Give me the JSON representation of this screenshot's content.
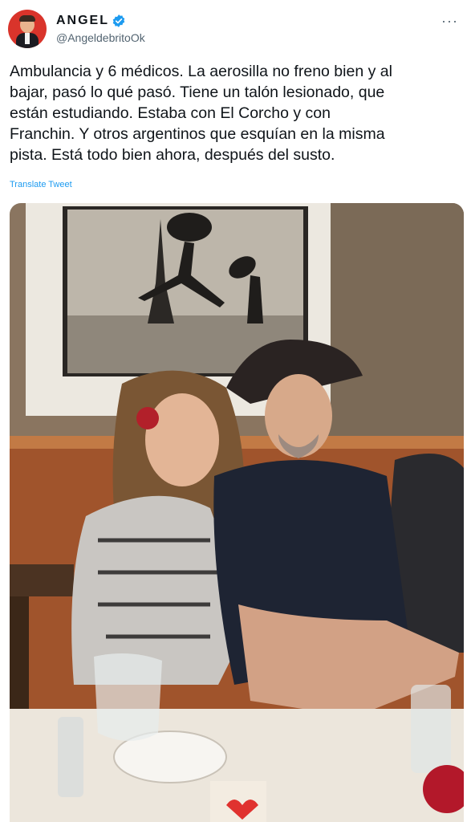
{
  "author": {
    "display_name": "ANGEL",
    "handle": "@AngeldebritoOk",
    "verified_icon": "verified-badge-icon",
    "avatar_icon": "avatar-caricature-icon"
  },
  "more_icon": "more-options-icon",
  "tweet": {
    "text": "Ambulancia y 6 médicos. La aerosilla no freno bien y al\nbajar, pasó lo qué pasó. Tiene un talón lesionado, que\nestán estudiando. Estaba con El Corcho y con\nFranchin. Y otros  argentinos que esquían en la misma\npista. Está todo bien ahora, después del susto.",
    "translate_label": "Translate Tweet"
  },
  "media": {
    "type": "photo",
    "content": "woman-and-man-in-hat-at-restaurant-table"
  },
  "colors": {
    "link": "#1d9bf0",
    "secondary_text": "#536471",
    "primary_text": "#0f1419",
    "verified": "#1d9bf0"
  }
}
